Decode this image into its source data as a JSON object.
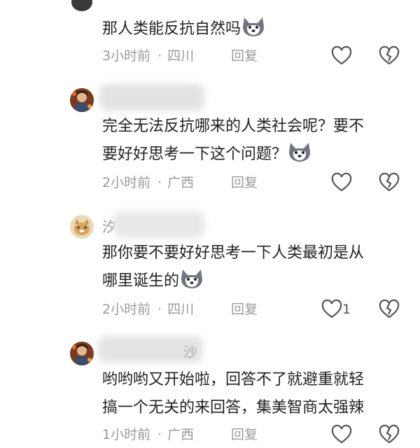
{
  "comments": [
    {
      "lines": [
        "那人类能反抗自然吗"
      ],
      "time": "3小时前",
      "location": "四川",
      "reply": "回复",
      "likes": ""
    },
    {
      "lines": [
        "完全无法反抗哪来的人类社会呢？要不",
        "要好好思考一下这个问题？"
      ],
      "time": "2小时前",
      "location": "广西",
      "reply": "回复",
      "likes": ""
    },
    {
      "name_fragment": "汐",
      "lines": [
        "那你要不要好好思考一下人类最初是从",
        "哪里诞生的"
      ],
      "time": "2小时前",
      "location": "四川",
      "reply": "回复",
      "likes": "1"
    },
    {
      "name_fragment": "沙",
      "lines": [
        "哟哟哟又开始啦，回答不了就避重就轻",
        "搞一个无关的来回答，集美智商太强辣"
      ],
      "time": "1小时前",
      "location": "广西",
      "reply": "回复",
      "likes": ""
    }
  ],
  "icons": {
    "like": "heart-outline-icon",
    "dislike": "broken-heart-icon",
    "emoji": "husky-dog-emoji"
  },
  "colors": {
    "meta": "#9a9a9a",
    "text": "#222222"
  }
}
